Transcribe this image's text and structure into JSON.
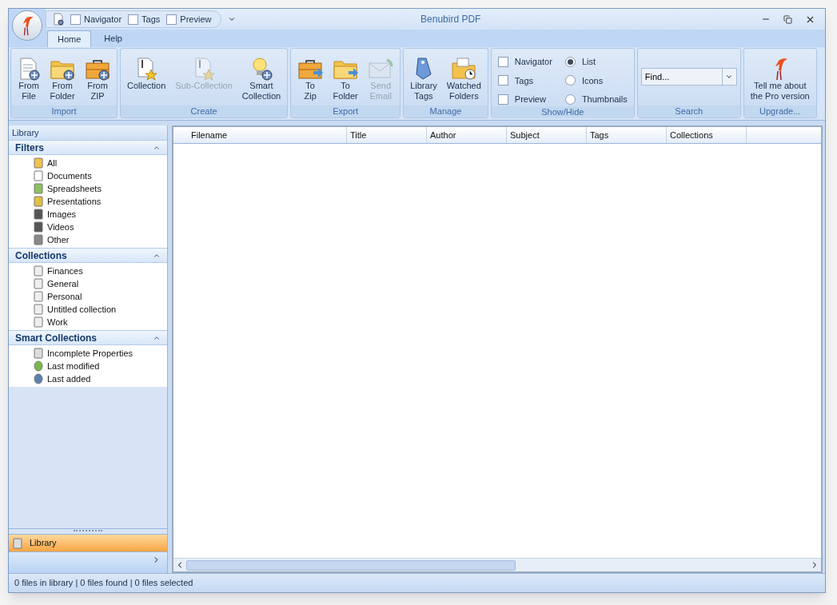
{
  "window": {
    "title": "Benubird PDF"
  },
  "quick_access": [
    {
      "label": "Navigator",
      "checked": false
    },
    {
      "label": "Tags",
      "checked": false
    },
    {
      "label": "Preview",
      "checked": false
    }
  ],
  "ribbon_tabs": [
    {
      "label": "Home",
      "selected": true
    },
    {
      "label": "Help",
      "selected": false
    }
  ],
  "ribbon_groups": [
    {
      "kind": "buttons",
      "label": "Import",
      "buttons": [
        {
          "label": "From\nFile",
          "disabled": false
        },
        {
          "label": "From\nFolder",
          "disabled": false
        },
        {
          "label": "From\nZIP",
          "disabled": false
        }
      ]
    },
    {
      "kind": "buttons",
      "label": "Create",
      "buttons": [
        {
          "label": "Collection",
          "disabled": false
        },
        {
          "label": "Sub-Collection",
          "disabled": true
        },
        {
          "label": "Smart\nCollection",
          "disabled": false
        }
      ]
    },
    {
      "kind": "buttons",
      "label": "Export",
      "buttons": [
        {
          "label": "To\nZip",
          "disabled": false
        },
        {
          "label": "To\nFolder",
          "disabled": false
        },
        {
          "label": "Send\nEmail",
          "disabled": true
        }
      ]
    },
    {
      "kind": "buttons",
      "label": "Manage",
      "buttons": [
        {
          "label": "Library\nTags",
          "disabled": false
        },
        {
          "label": "Watched\nFolders",
          "disabled": false
        }
      ]
    },
    {
      "kind": "options",
      "label": "Show/Hide",
      "checks": [
        {
          "label": "Navigator",
          "checked": false
        },
        {
          "label": "Tags",
          "checked": false
        },
        {
          "label": "Preview",
          "checked": false
        }
      ],
      "views": [
        {
          "label": "List",
          "selected": true
        },
        {
          "label": "Icons",
          "selected": false
        },
        {
          "label": "Thumbnails",
          "selected": false
        }
      ]
    },
    {
      "kind": "search",
      "label": "Search",
      "placeholder": "Find..."
    },
    {
      "kind": "buttons",
      "label": "Upgrade...",
      "buttons": [
        {
          "label": "Tell me about\nthe Pro version",
          "disabled": false
        }
      ]
    }
  ],
  "sidebar": {
    "title": "Library",
    "sections": [
      {
        "title": "Filters",
        "expanded": true,
        "items": [
          "All",
          "Documents",
          "Spreadsheets",
          "Presentations",
          "Images",
          "Videos",
          "Other"
        ]
      },
      {
        "title": "Collections",
        "expanded": true,
        "items": [
          "Finances",
          "General",
          "Personal",
          "Untitled collection",
          "Work"
        ]
      },
      {
        "title": "Smart Collections",
        "expanded": true,
        "items": [
          "Incomplete Properties",
          "Last modified",
          "Last added"
        ]
      }
    ],
    "nav_buttons": [
      {
        "label": "Library",
        "selected": true
      }
    ]
  },
  "table": {
    "columns": [
      "Filename",
      "Title",
      "Author",
      "Subject",
      "Tags",
      "Collections"
    ]
  },
  "status_bar": "0 files in library | 0 files found | 0 files selected"
}
